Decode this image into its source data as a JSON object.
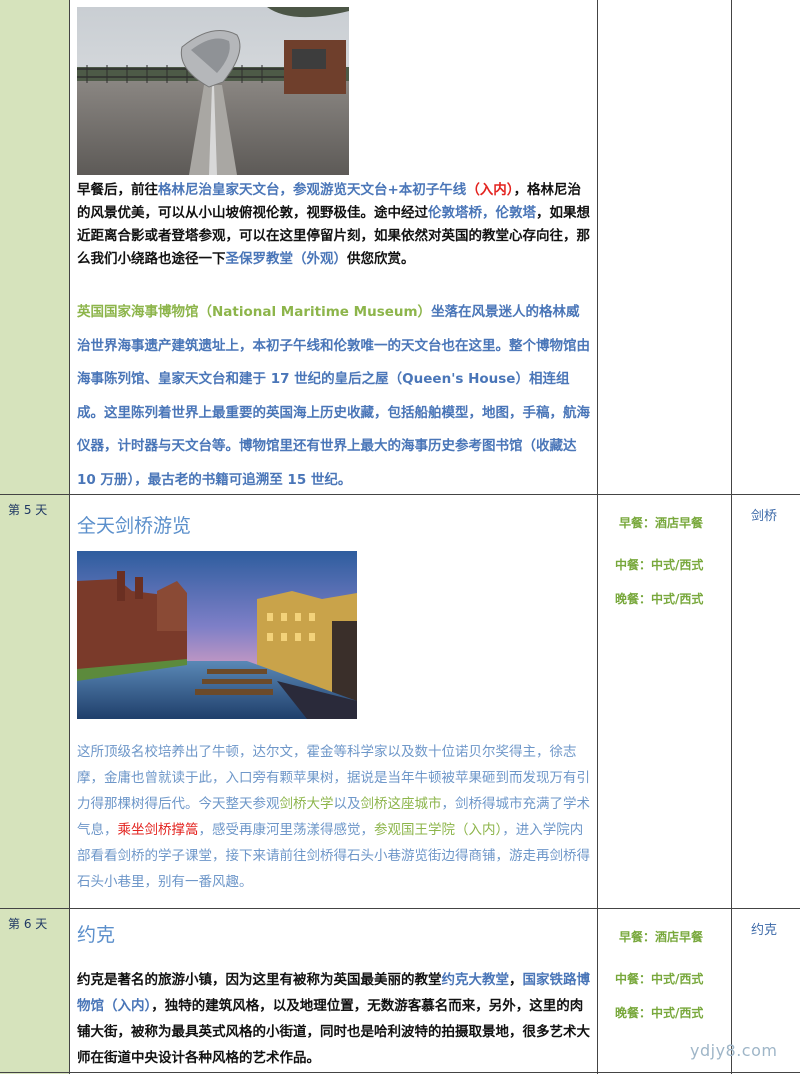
{
  "days": [
    {
      "label": "第 5 天"
    },
    {
      "label": "第 6 天"
    }
  ],
  "greenwich": {
    "para1": {
      "t1": "早餐后，前往",
      "l1": "格林尼治皇家天文台，参观游览天文台+本初子午线",
      "l2": "（入内）",
      "t2": "，格林尼治的风景优美，可以从小山坡俯视伦敦，视野极佳。途中经过",
      "l3": "伦敦塔桥，伦敦塔",
      "t3": "，如果想近距离合影或者登塔参观，可以在这里停留片刻，如果依然对英国的教堂心存向往，那么我们小绕路也途径一下",
      "l4": "圣保罗教堂（外观）",
      "t4": "供您欣赏。"
    },
    "para2": {
      "g1": "英国国家海事博物馆（National Maritime Museum）",
      "t1": "坐落在风景迷人的格林威治世界海事遗产建筑遗址上，本初子午线和伦敦唯一的天文台也在这里。整个博物馆由海事陈列馆、皇家天文台和建于 17 世纪的皇后之屋（Queen's House）相连组成。这里陈列着世界上最重要的英国海上历史收藏，包括船舶模型，地图，手稿，航海仪器，计时器与天文台等。博物馆里还有世界上最大的海事历史参考图书馆（收藏达 10 万册），最古老的书籍可追溯至 15 世纪。"
    }
  },
  "day5": {
    "title": "全天剑桥游览",
    "meals": {
      "breakfast": "早餐：酒店早餐",
      "lunch": "中餐：中式/西式",
      "dinner": "晚餐：中式/西式"
    },
    "city": "剑桥",
    "para": {
      "t1": "这所顶级名校培养出了牛顿，达尔文，霍金等科学家以及数十位诺贝尔奖得主，徐志摩，金庸也曾就读于此，入口旁有颗苹果树，据说是当年牛顿被苹果砸到而发现万有引力得那棵树得后代。今天整天参观",
      "g1": "剑桥大学",
      "t2": "以及",
      "g2": "剑桥这座城市",
      "t3": "，剑桥得城市充满了学术气息，",
      "r1": "乘坐剑桥撑篙",
      "t4": "，感受再康河里荡漾得感觉，",
      "g3": "参观国王学院（入内）",
      "t5": "，进入学院内部看看剑桥的学子课堂，接下来请前往剑桥得石头小巷游览街边得商铺，游走再剑桥得石头小巷里，别有一番风趣。"
    }
  },
  "day6": {
    "title": "约克",
    "meals": {
      "breakfast": "早餐：酒店早餐",
      "lunch": "中餐：中式/西式",
      "dinner": "晚餐：中式/西式"
    },
    "city": "约克",
    "para": {
      "t1": "约克是著名的旅游小镇，因为这里有被称为英国最美丽的教堂",
      "l1": "约克大教堂",
      "t2": "，",
      "l2": "国家铁路博物馆（入内）",
      "t3": "，独特的建筑风格，以及地理位置，无数游客慕名而来，另外，这里的肉铺大街，被称为最具英式风格的小街道，同时也是哈利波特的拍摄取景地，很多艺术大师在街道中央设计各种风格的艺术作品。"
    }
  },
  "watermark": "ydjy8.com"
}
